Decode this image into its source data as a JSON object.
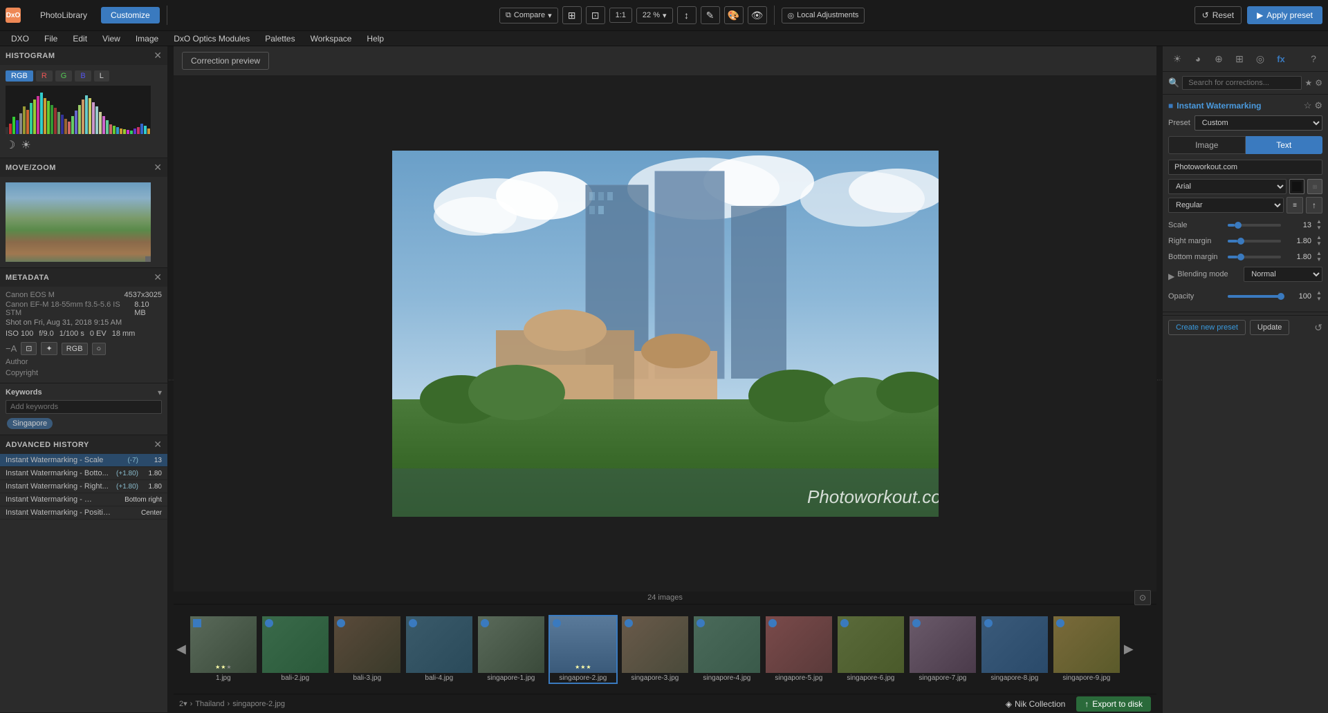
{
  "app": {
    "title": "DxO PhotoLibrary",
    "logo": "DxO",
    "tabs": [
      {
        "label": "PhotoLibrary",
        "active": false
      },
      {
        "label": "Customize",
        "active": true
      }
    ]
  },
  "toolbar": {
    "compare_label": "Compare",
    "zoom_label": "22 %",
    "local_adj_label": "Local Adjustments",
    "reset_label": "Reset",
    "apply_preset_label": "Apply preset",
    "zoom_1_label": "1:1"
  },
  "menu": {
    "items": [
      "DXO",
      "File",
      "Edit",
      "View",
      "Image",
      "DxO Optics Modules",
      "Palettes",
      "Workspace",
      "Help"
    ]
  },
  "left_panel": {
    "histogram": {
      "title": "HISTOGRAM",
      "tabs": [
        "RGB",
        "R",
        "G",
        "B",
        "L"
      ]
    },
    "move_zoom": {
      "title": "MOVE/ZOOM"
    },
    "metadata": {
      "title": "METADATA",
      "camera": "Canon EOS M",
      "dimensions": "4537x3025",
      "lens": "Canon EF-M 18-55mm f3.5-5.6 IS STM",
      "file_size": "8.10 MB",
      "date": "Shot on Fri, Aug 31, 2018 9:15 AM",
      "iso": "ISO 100",
      "aperture": "f/9.0",
      "shutter": "1/100 s",
      "ev": "0 EV",
      "focal": "18 mm",
      "author_label": "Author",
      "author_value": "",
      "copyright_label": "Copyright",
      "copyright_value": ""
    },
    "keywords": {
      "title": "Keywords",
      "placeholder": "Add keywords",
      "tags": [
        "Singapore"
      ]
    },
    "history": {
      "title": "ADVANCED HISTORY",
      "items": [
        {
          "name": "Instant Watermarking - Scale",
          "delta": "(-7)",
          "value": "13",
          "active": true
        },
        {
          "name": "Instant Watermarking - Botto...",
          "delta": "(+1.80)",
          "value": "1.80",
          "active": false
        },
        {
          "name": "Instant Watermarking - Right...",
          "delta": "(+1.80)",
          "value": "1.80",
          "active": false
        },
        {
          "name": "Instant Watermarking - Position",
          "delta": "",
          "value": "Bottom right",
          "active": false
        },
        {
          "name": "Instant Watermarking - Position",
          "delta": "",
          "value": "Center",
          "active": false
        }
      ]
    }
  },
  "correction_preview": {
    "label": "Correction preview"
  },
  "image": {
    "watermark_text": "Photoworkout.com"
  },
  "right_panel": {
    "search_placeholder": "Search for corrections...",
    "tools": [
      "light-icon",
      "color-icon",
      "detail-icon",
      "geometry-icon",
      "local-icon",
      "fx-icon"
    ],
    "watermark": {
      "title": "Instant Watermarking",
      "preset_label": "Preset",
      "preset_value": "Custom",
      "tabs": [
        {
          "label": "Image",
          "active": false
        },
        {
          "label": "Text",
          "active": true
        }
      ],
      "text_value": "Photoworkout.com",
      "font_label": "Arial",
      "style_label": "Regular",
      "scale": {
        "label": "Scale",
        "value": "13",
        "percent": 13
      },
      "right_margin": {
        "label": "Right margin",
        "value": "1.80",
        "percent": 18
      },
      "bottom_margin": {
        "label": "Bottom margin",
        "value": "1.80",
        "percent": 18
      },
      "blending_mode": {
        "label": "Blending mode",
        "value": "Normal"
      },
      "opacity": {
        "label": "Opacity",
        "value": "100",
        "percent": 100
      },
      "create_preset_label": "Create new preset",
      "update_label": "Update"
    }
  },
  "filmstrip": {
    "count": "24 images",
    "nik_label": "Nik Collection",
    "export_label": "Export to disk",
    "thumbs": [
      {
        "label": "1.jpg",
        "color": "tc-1"
      },
      {
        "label": "bali-2.jpg",
        "color": "tc-2"
      },
      {
        "label": "bali-3.jpg",
        "color": "tc-3"
      },
      {
        "label": "bali-4.jpg",
        "color": "tc-4"
      },
      {
        "label": "singapore-1.jpg",
        "color": "tc-1"
      },
      {
        "label": "singapore-2.jpg",
        "color": "tc-5",
        "selected": true
      },
      {
        "label": "singapore-3.jpg",
        "color": "tc-6"
      },
      {
        "label": "singapore-4.jpg",
        "color": "tc-7"
      },
      {
        "label": "singapore-5.jpg",
        "color": "tc-8"
      },
      {
        "label": "singapore-6.jpg",
        "color": "tc-9"
      },
      {
        "label": "singapore-7.jpg",
        "color": "tc-10"
      },
      {
        "label": "singapore-8.jpg",
        "color": "tc-11"
      },
      {
        "label": "singapore-9.jpg",
        "color": "tc-12"
      }
    ]
  },
  "status_bar": {
    "path_parts": [
      "2▾",
      "Thailand",
      "singapore-2.jpg"
    ]
  }
}
